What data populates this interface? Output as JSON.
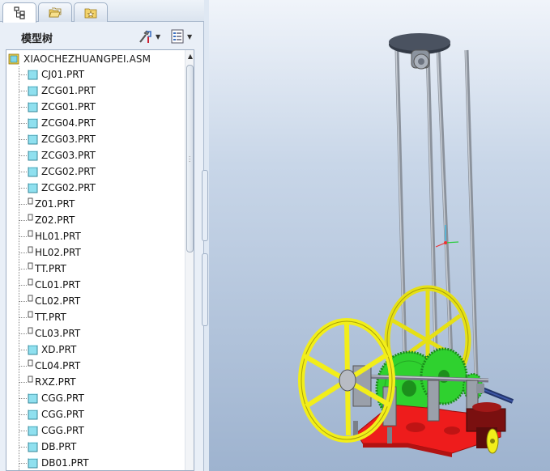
{
  "tabs": [
    {
      "icon": "model-tree-icon"
    },
    {
      "icon": "folder-browser-icon"
    },
    {
      "icon": "favorites-icon"
    }
  ],
  "panel": {
    "title": "模型树",
    "settings_icon": "tree-settings-icon",
    "columns_icon": "tree-columns-icon"
  },
  "tree": {
    "root": "XIAOCHEZHUANGPEI.ASM",
    "items": [
      {
        "label": "CJ01.PRT",
        "kind": "part"
      },
      {
        "label": "ZCG01.PRT",
        "kind": "part"
      },
      {
        "label": "ZCG01.PRT",
        "kind": "part"
      },
      {
        "label": "ZCG04.PRT",
        "kind": "part"
      },
      {
        "label": "ZCG03.PRT",
        "kind": "part"
      },
      {
        "label": "ZCG03.PRT",
        "kind": "part"
      },
      {
        "label": "ZCG02.PRT",
        "kind": "part"
      },
      {
        "label": "ZCG02.PRT",
        "kind": "part"
      },
      {
        "label": "Z01.PRT",
        "kind": "small"
      },
      {
        "label": "Z02.PRT",
        "kind": "small"
      },
      {
        "label": "HL01.PRT",
        "kind": "small"
      },
      {
        "label": "HL02.PRT",
        "kind": "small"
      },
      {
        "label": "TT.PRT",
        "kind": "small"
      },
      {
        "label": "CL01.PRT",
        "kind": "small"
      },
      {
        "label": "CL02.PRT",
        "kind": "small"
      },
      {
        "label": "TT.PRT",
        "kind": "small"
      },
      {
        "label": "CL03.PRT",
        "kind": "small"
      },
      {
        "label": "XD.PRT",
        "kind": "part"
      },
      {
        "label": "CL04.PRT",
        "kind": "small"
      },
      {
        "label": "RXZ.PRT",
        "kind": "small"
      },
      {
        "label": "CGG.PRT",
        "kind": "part"
      },
      {
        "label": "CGG.PRT",
        "kind": "part"
      },
      {
        "label": "CGG.PRT",
        "kind": "part"
      },
      {
        "label": "DB.PRT",
        "kind": "part"
      },
      {
        "label": "DB01.PRT",
        "kind": "part"
      }
    ]
  },
  "colors": {
    "wheel": "#f2ee1a",
    "gear": "#2fd12f",
    "base": "#ee1c1c",
    "rod": "#9aa2ad",
    "top_plate": "#3c4350"
  }
}
